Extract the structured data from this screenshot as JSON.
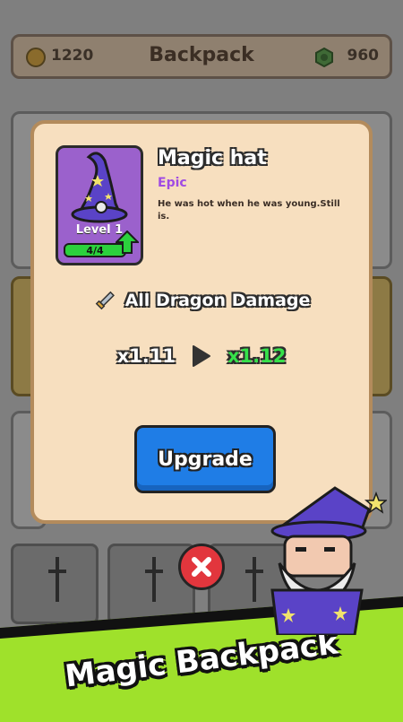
{
  "header": {
    "title": "Backpack",
    "gold": "1220",
    "gems": "960"
  },
  "modal": {
    "item": {
      "name": "Magic hat",
      "rarity": "Epic",
      "description": "He was hot when he was young.Still is.",
      "level": "Level 1",
      "progress": "4/4",
      "progress_fraction": 1.0
    },
    "stat": {
      "label": "All Dragon Damage",
      "icon": "sword-icon"
    },
    "multiplier": {
      "current": "x1.11",
      "next": "x1.12"
    },
    "upgrade_label": "Upgrade"
  },
  "banner": {
    "text": "Magic Backpack"
  },
  "colors": {
    "accent_blue": "#1f7de6",
    "epic_purple": "#a04be3",
    "green": "#36e14a",
    "red": "#e2363d"
  }
}
